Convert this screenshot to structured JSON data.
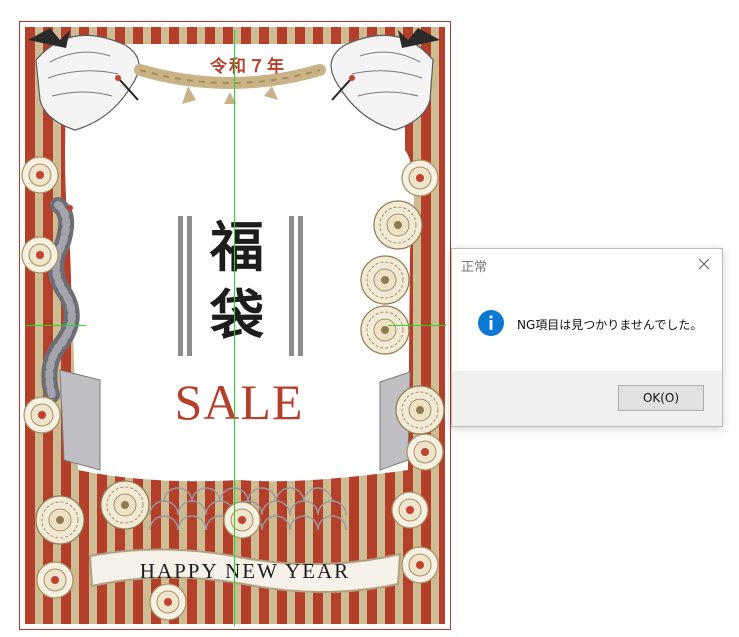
{
  "poster": {
    "era_text": "令和７年",
    "main_title": "福袋",
    "sale_text": "SALE",
    "banner_text": "HAPPY NEW YEAR",
    "colors": {
      "red": "#b4402c",
      "beige": "#cdbb93",
      "ink": "#1d1d1d",
      "gray": "#8d8d8d",
      "guide_line": "#22dd22"
    }
  },
  "dialog": {
    "title": "正常",
    "message": "NG項目は見つかりませんでした。",
    "ok_label": "OK(O)",
    "close_icon": "close-icon",
    "status_icon": "info-icon",
    "accent": "#0b78d4"
  }
}
